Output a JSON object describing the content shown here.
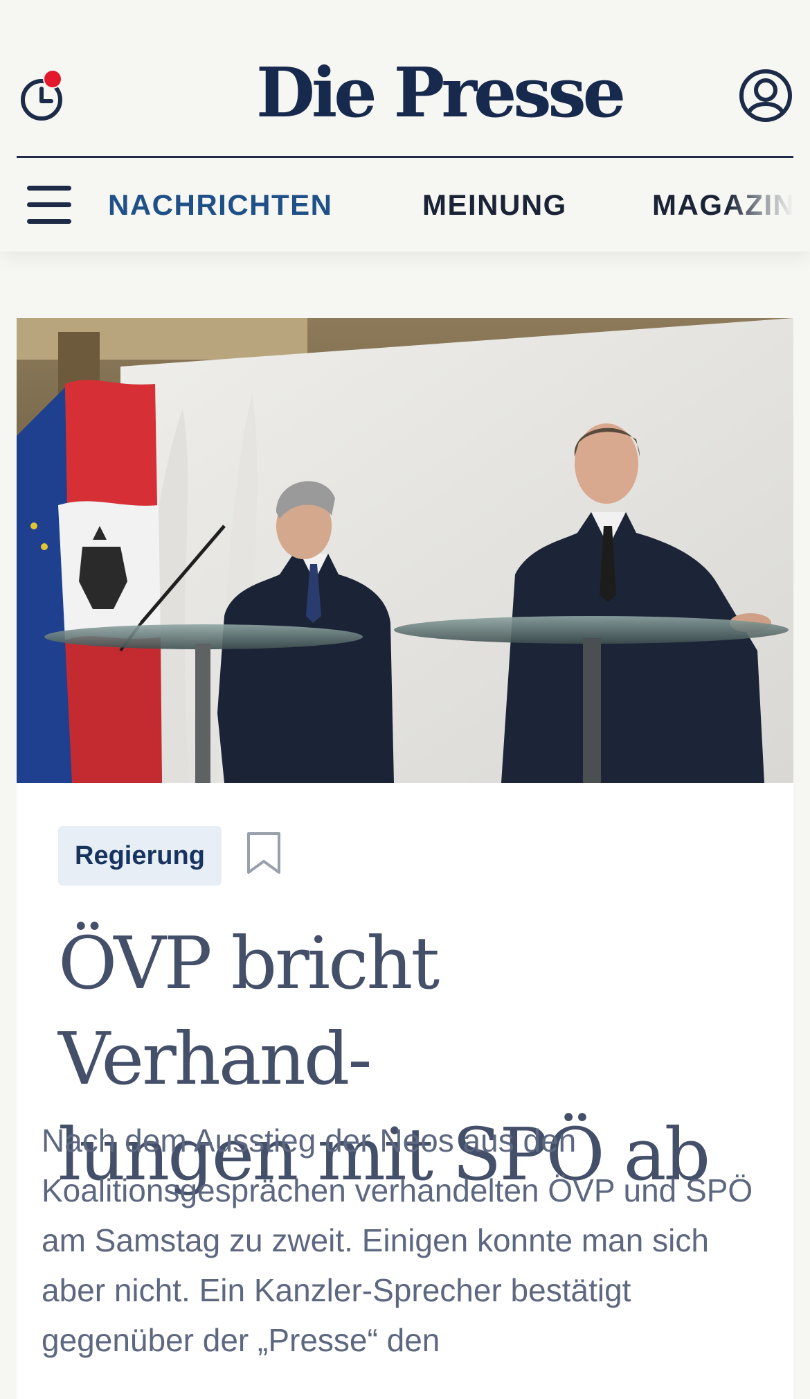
{
  "header": {
    "logo": "Die Presse",
    "history_icon": "clock-icon",
    "account_icon": "user-circle-icon",
    "notification_color": "#e3182d"
  },
  "nav": {
    "menu_icon": "hamburger-menu-icon",
    "items": [
      {
        "label": "NACHRICHTEN",
        "active": true,
        "color": "#1f5188"
      },
      {
        "label": "MEINUNG",
        "active": false,
        "color": "#1b2436"
      },
      {
        "label": "MAGAZIN",
        "active": false,
        "color": "#1b2436"
      }
    ]
  },
  "article": {
    "image_alt": "Zwei Politiker stehen an Stehtischen vor österreichischer und EU-Flagge",
    "tag": "Regierung",
    "bookmark_icon": "bookmark-icon",
    "headline_line1": "ÖVP bricht Verhand-",
    "headline_line2": "lungen mit SPÖ ab",
    "lead": "Nach dem Ausstieg der Neos aus den Koalitionsgesprächen verhandelten ÖVP und SPÖ am Samstag zu zweit. Einigen konnte man sich aber nicht. Ein Kanzler-Sprecher bestätigt gegenüber der „Presse“ den"
  },
  "colors": {
    "brand": "#17294d",
    "background": "#f6f6f3",
    "tag_background": "#e8eef6",
    "headline": "#444f69"
  }
}
